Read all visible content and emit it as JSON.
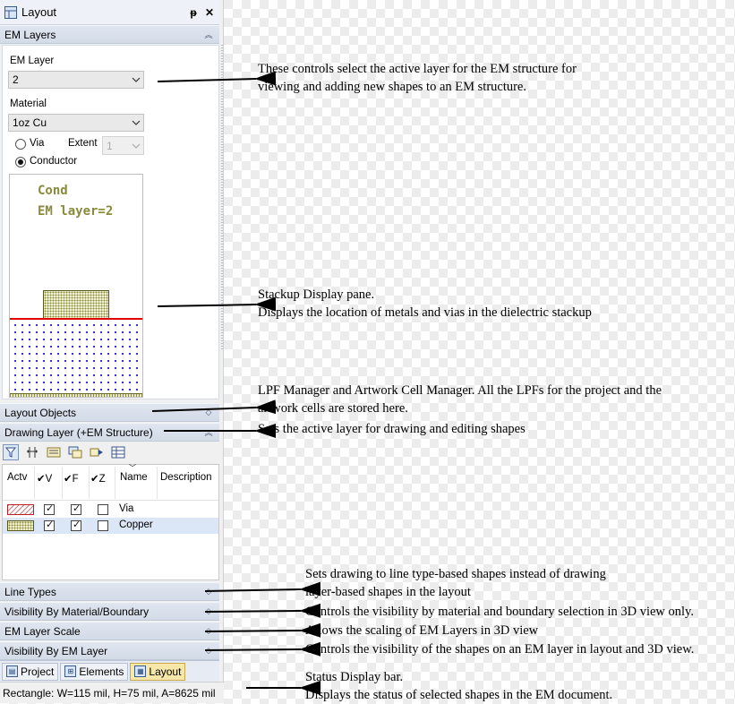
{
  "panel": {
    "title": "Layout",
    "pin_glyph": "ᵽ",
    "close_glyph": "✕",
    "sections": {
      "em_layers": "EM Layers",
      "layout_objects": "Layout Objects",
      "drawing_layer": "Drawing Layer (+EM Structure)",
      "line_types": "Line Types",
      "visibility_material": "Visibility By Material/Boundary",
      "em_layer_scale": "EM Layer Scale",
      "visibility_em_layer": "Visibility By EM Layer"
    }
  },
  "em_layers": {
    "em_layer_label": "EM Layer",
    "em_layer_value": "2",
    "material_label": "Material",
    "material_value": "1oz Cu",
    "via_label": "Via",
    "extent_label": "Extent",
    "extent_value": "1",
    "conductor_label": "Conductor",
    "selected_mode": "Conductor",
    "stackup": {
      "line1": "Cond",
      "line2": "EM layer=2",
      "colors": {
        "metal": "#8d8d40",
        "interface": "#e00000",
        "dielectric_dots": "#2a2ad0"
      }
    }
  },
  "drawing_layer": {
    "toolbar_icons": [
      "filter-icon",
      "columns-icon",
      "layer-props-icon",
      "layer-copy-icon",
      "layer-move-icon",
      "layer-grid-icon"
    ],
    "columns": [
      "Actv",
      "V",
      "F",
      "Z",
      "Name",
      "Description"
    ],
    "rows": [
      {
        "name": "Via",
        "description": "",
        "visible": true,
        "frozen": true,
        "z": false,
        "swatch": "via"
      },
      {
        "name": "Copper",
        "description": "",
        "visible": true,
        "frozen": true,
        "z": false,
        "swatch": "copper",
        "active": true
      }
    ]
  },
  "tabs": [
    {
      "label": "Project",
      "icon": "project-icon"
    },
    {
      "label": "Elements",
      "icon": "elements-icon"
    },
    {
      "label": "Layout",
      "icon": "layout-icon",
      "active": true
    }
  ],
  "status_bar": "Rectangle: W=115 mil, H=75 mil, A=8625 mil",
  "annotations": {
    "em_layer_controls": [
      "These controls select the active layer for the EM structure for",
      "viewing and adding new shapes to an EM structure."
    ],
    "stackup_pane": [
      "Stackup Display pane.",
      "Displays the location of metals and vias in the dielectric stackup"
    ],
    "layout_objects": [
      "LPF Manager and Artwork Cell Manager. All the LPFs for the project and the",
      "artwork cells are stored here."
    ],
    "drawing_layer": [
      "Sets the active layer for drawing and editing shapes"
    ],
    "line_types": [
      "Sets drawing to line type-based shapes instead of drawing",
      "layer-based shapes in the layout"
    ],
    "visibility_material": [
      "Controls the visibility by material and boundary selection in 3D view only."
    ],
    "em_layer_scale": [
      "Allows the scaling of EM Layers in 3D view"
    ],
    "visibility_em_layer": [
      "Controls the visibility of the shapes on an EM layer in layout and 3D view."
    ],
    "status_bar": [
      "Status Display bar.",
      "Displays the status of selected shapes in the EM document."
    ]
  }
}
